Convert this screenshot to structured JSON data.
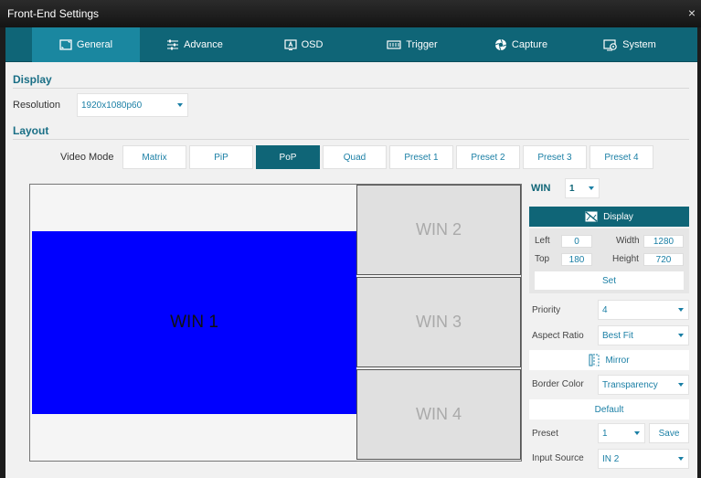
{
  "window": {
    "title": "Front-End Settings",
    "close_glyph": "×"
  },
  "tabs": [
    {
      "label": "General",
      "icon": "screen-icon",
      "active": true
    },
    {
      "label": "Advance",
      "icon": "sliders-icon"
    },
    {
      "label": "OSD",
      "icon": "osd-icon"
    },
    {
      "label": "Trigger",
      "icon": "trigger-icon"
    },
    {
      "label": "Capture",
      "icon": "camera-icon"
    },
    {
      "label": "System",
      "icon": "system-gear-icon"
    }
  ],
  "display": {
    "section_title": "Display",
    "resolution_label": "Resolution",
    "resolution_value": "1920x1080p60"
  },
  "layout": {
    "section_title": "Layout",
    "video_mode_label": "Video Mode",
    "modes": [
      "Matrix",
      "PiP",
      "PoP",
      "Quad",
      "Preset 1",
      "Preset 2",
      "Preset 3",
      "Preset 4"
    ],
    "active_mode": "PoP"
  },
  "canvas": {
    "windows": [
      "WIN 1",
      "WIN 2",
      "WIN 3",
      "WIN 4"
    ],
    "win1_color": "#0000ff"
  },
  "win_panel": {
    "win_label": "WIN",
    "win_value": "1",
    "display_button": "Display",
    "left_label": "Left",
    "left_value": "0",
    "top_label": "Top",
    "top_value": "180",
    "width_label": "Width",
    "width_value": "1280",
    "height_label": "Height",
    "height_value": "720",
    "set_button": "Set",
    "priority_label": "Priority",
    "priority_value": "4",
    "aspect_label": "Aspect Ratio",
    "aspect_value": "Best Fit",
    "mirror_button": "Mirror",
    "border_label": "Border Color",
    "border_value": "Transparency",
    "default_button": "Default",
    "preset_label": "Preset",
    "preset_value": "1",
    "save_button": "Save",
    "input_label": "Input Source",
    "input_value": "IN 2"
  },
  "colors": {
    "accent": "#0f6577",
    "accent_active": "#1a87a0",
    "link": "#1a7fa5"
  }
}
